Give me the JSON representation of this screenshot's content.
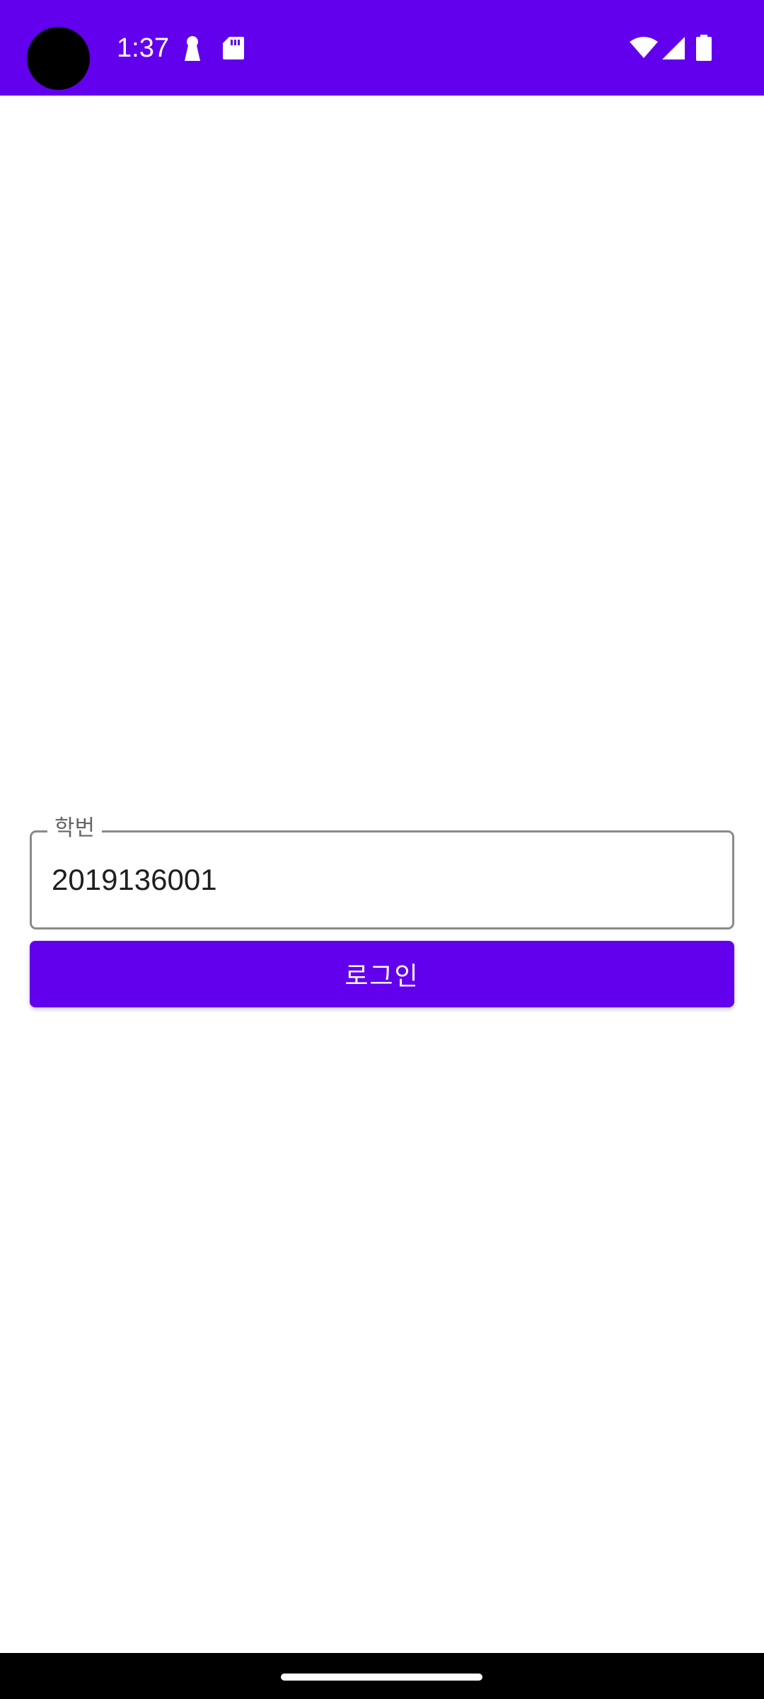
{
  "status_bar": {
    "time": "1:37",
    "background_color": "#6200ee",
    "left_icons": [
      "keyhole-icon",
      "sd-card-icon"
    ],
    "right_icons": [
      "wifi-icon",
      "cellular-signal-icon",
      "battery-icon"
    ]
  },
  "login_form": {
    "student_id_label": "학번",
    "student_id_value": "2019136001",
    "login_button_label": "로그인",
    "accent_color": "#6200ee"
  },
  "nav_bar": {
    "gesture": "home-handle"
  }
}
